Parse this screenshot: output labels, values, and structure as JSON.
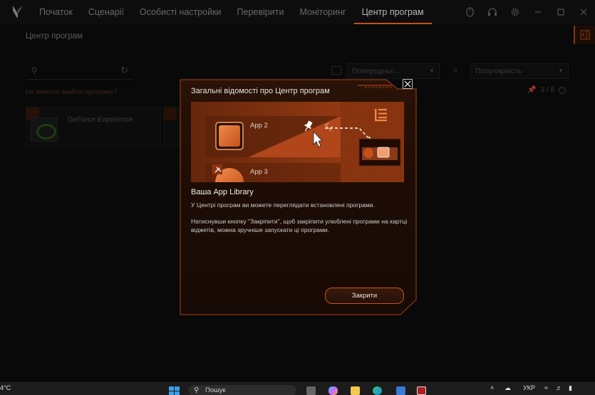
{
  "app": {
    "tabs": [
      {
        "label": "Початок",
        "active": false
      },
      {
        "label": "Сценарії",
        "active": false
      },
      {
        "label": "Особисті настройки",
        "active": false
      },
      {
        "label": "Перевірити",
        "active": false
      },
      {
        "label": "Моніторинг",
        "active": false
      },
      {
        "label": "Центр програм",
        "active": true
      }
    ],
    "window_icons": [
      "mouse-icon",
      "headset-icon",
      "gear-icon",
      "minimize-icon",
      "maximize-icon",
      "close-icon"
    ],
    "page_title": "Центр програм",
    "search_placeholder": "",
    "cant_find_link": "Не можете знайти програму?",
    "sort_primary": "Попередньо...",
    "sort_secondary": "Популярність",
    "pinned_count": "3 / 8",
    "apps": [
      {
        "name": "GeForce Experience",
        "pinned": true
      }
    ],
    "accent_color": "#c5501c"
  },
  "modal": {
    "title": "Загальні відомості про Центр програм",
    "hero": {
      "app2_label": "App 2",
      "app3_label": "App 3"
    },
    "section_title": "Ваша App Library",
    "paragraph1": "У Центрі програм ви можете переглядати встановлені програми.",
    "paragraph2": "Натиснувши кнопку \"Закріпити\", щоб закріпити улюблені програми на картці віджетів, можна зручніше запускати ці програми.",
    "close_button": "Закрити",
    "close_icon": "close-icon"
  },
  "taskbar": {
    "temperature": "4°C",
    "search_label": "Пошук",
    "language": "УКР"
  }
}
